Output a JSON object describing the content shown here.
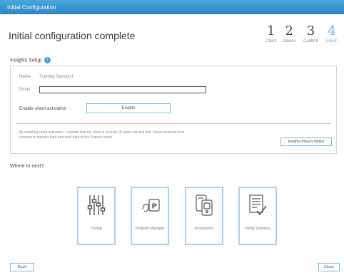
{
  "window": {
    "title": "Initial Configuration"
  },
  "header": {
    "title": "Initial configuration complete",
    "steps": [
      {
        "number": "1",
        "label": "Client",
        "active": false
      },
      {
        "number": "2",
        "label": "Device",
        "active": false
      },
      {
        "number": "3",
        "label": "Confirm",
        "active": false
      },
      {
        "number": "4",
        "label": "Finish",
        "active": true
      }
    ]
  },
  "insights": {
    "section_label": "Insights Setup",
    "info_icon": "i",
    "name_label": "Name",
    "name_value": "Training Session1",
    "email_label": "Email",
    "email_value": "",
    "enable_label": "Enable client activation",
    "enable_button": "Enable",
    "consent_text": "By enabling client activation, I confirm that my client is at least 18 years old and that I have received their consent to transfer their personal data to the Sonova cloud.",
    "privacy_button": "Insights Privacy Notice"
  },
  "where_next": {
    "label": "Where to next?",
    "tiles": [
      {
        "label": "Tuning",
        "icon": "sliders-icon"
      },
      {
        "label": "Program Manager",
        "icon": "program-manager-icon"
      },
      {
        "label": "Accessories",
        "icon": "accessories-icon"
      },
      {
        "label": "Fitting Summary",
        "icon": "fitting-summary-icon"
      }
    ]
  },
  "footer": {
    "back_label": "Back",
    "close_label": "Close"
  },
  "colors": {
    "titlebar": "#2a86c6",
    "accent": "#6db4e6",
    "tile_border": "#a9d3ef"
  }
}
